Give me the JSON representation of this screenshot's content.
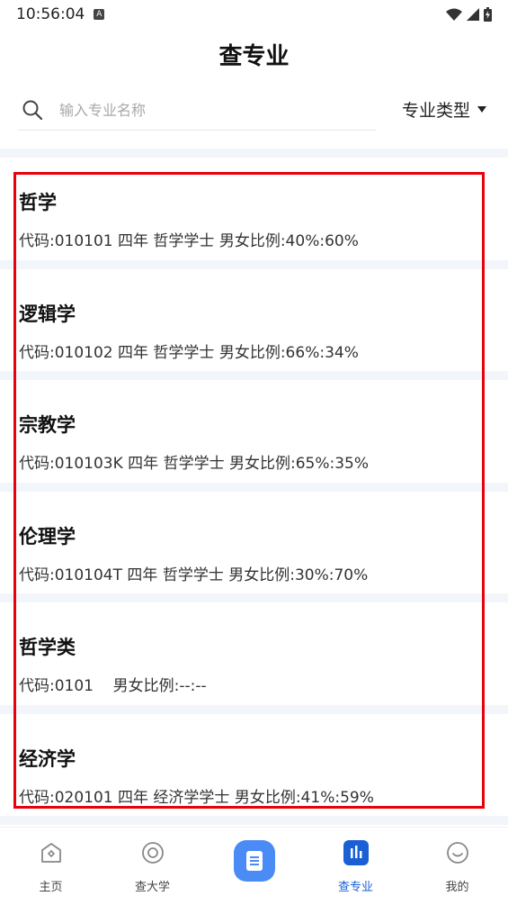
{
  "status_bar": {
    "time": "10:56:04",
    "notif_letter": "A"
  },
  "header": {
    "title": "查专业"
  },
  "search": {
    "placeholder": "输入专业名称"
  },
  "filter": {
    "label": "专业类型"
  },
  "majors": [
    {
      "name": "哲学",
      "info": "代码:010101 四年 哲学学士 男女比例:40%:60%"
    },
    {
      "name": "逻辑学",
      "info": "代码:010102 四年 哲学学士 男女比例:66%:34%"
    },
    {
      "name": "宗教学",
      "info": "代码:010103K 四年 哲学学士 男女比例:65%:35%"
    },
    {
      "name": "伦理学",
      "info": "代码:010104T 四年 哲学学士 男女比例:30%:70%"
    },
    {
      "name": "哲学类",
      "info": "代码:0101    男女比例:--:--"
    },
    {
      "name": "经济学",
      "info": "代码:020101 四年 经济学学士 男女比例:41%:59%"
    }
  ],
  "nav": {
    "home": "主页",
    "university": "查大学",
    "major": "查专业",
    "mine": "我的"
  },
  "colors": {
    "accent": "#1a5fd6",
    "center_button": "#4a8bf5",
    "highlight": "#e8000b"
  }
}
